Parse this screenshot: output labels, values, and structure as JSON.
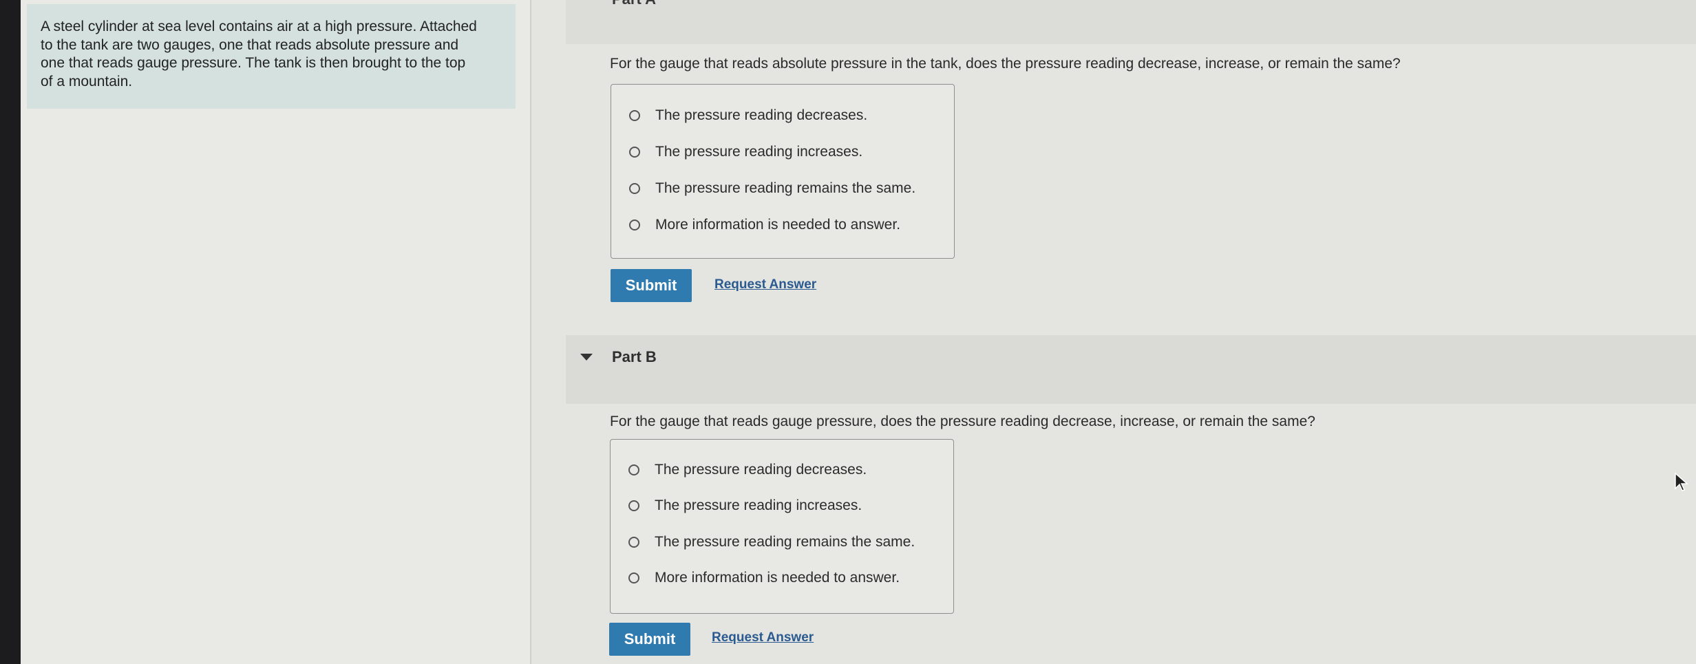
{
  "intro": {
    "text": "A steel cylinder at sea level contains air at a high pressure. Attached to the tank are two gauges, one that reads absolute pressure and one that reads gauge pressure. The tank is then brought to the top of a mountain."
  },
  "part_a": {
    "title": "Part A",
    "question": "For the gauge that reads absolute pressure in the tank, does the pressure reading decrease, increase, or remain the same?",
    "options": [
      "The pressure reading decreases.",
      "The pressure reading increases.",
      "The pressure reading remains the same.",
      "More information is needed to answer."
    ],
    "submit_label": "Submit",
    "request_label": "Request Answer"
  },
  "part_b": {
    "title": "Part B",
    "question": "For the gauge that reads gauge pressure, does the pressure reading decrease, increase, or remain the same?",
    "options": [
      "The pressure reading decreases.",
      "The pressure reading increases.",
      "The pressure reading remains the same.",
      "More information is needed to answer."
    ],
    "submit_label": "Submit",
    "request_label": "Request Answer"
  },
  "colors": {
    "accent": "#2f7bb0",
    "intro_bg": "#d5e1de",
    "link": "#2a5a8f"
  }
}
